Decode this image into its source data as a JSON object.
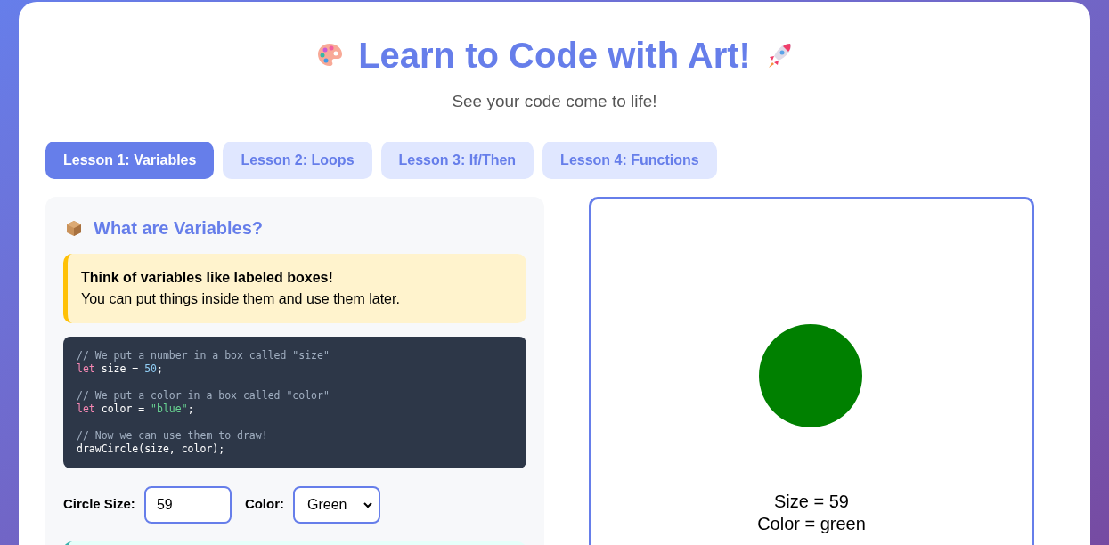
{
  "header": {
    "title": "Learn to Code with Art!",
    "subtitle": "See your code come to life!"
  },
  "tabs": [
    {
      "label": "Lesson 1: Variables",
      "selected": true
    },
    {
      "label": "Lesson 2: Loops",
      "selected": false
    },
    {
      "label": "Lesson 3: If/Then",
      "selected": false
    },
    {
      "label": "Lesson 4: Functions",
      "selected": false
    }
  ],
  "lesson": {
    "heading": "What are Variables?",
    "tip": {
      "title": "Think of variables like labeled boxes!",
      "text": "You can put things inside them and use them later."
    },
    "code": [
      {
        "kind": "line",
        "tokens": [
          {
            "kind": "comment",
            "text": "// We put a number in a box called \"size\""
          }
        ]
      },
      {
        "kind": "line",
        "tokens": [
          {
            "kind": "keyword",
            "text": "let"
          },
          {
            "kind": "plain",
            "text": " size = "
          },
          {
            "kind": "number",
            "text": "50"
          },
          {
            "kind": "plain",
            "text": ";"
          }
        ]
      },
      {
        "kind": "blank"
      },
      {
        "kind": "line",
        "tokens": [
          {
            "kind": "comment",
            "text": "// We put a color in a box called \"color\""
          }
        ]
      },
      {
        "kind": "line",
        "tokens": [
          {
            "kind": "keyword",
            "text": "let"
          },
          {
            "kind": "plain",
            "text": " color = "
          },
          {
            "kind": "string",
            "text": "\"blue\""
          },
          {
            "kind": "plain",
            "text": ";"
          }
        ]
      },
      {
        "kind": "blank"
      },
      {
        "kind": "line",
        "tokens": [
          {
            "kind": "comment",
            "text": "// Now we can use them to draw!"
          }
        ]
      },
      {
        "kind": "line",
        "tokens": [
          {
            "kind": "plain",
            "text": "drawCircle(size, color);"
          }
        ]
      }
    ],
    "size_field": {
      "label": "Circle Size:",
      "value": "59"
    },
    "color_field": {
      "label": "Color:",
      "value": "Green"
    }
  },
  "canvas": {
    "shapes": [
      {
        "kind": "circle",
        "color": "#008000"
      }
    ],
    "lines": [
      "Size = 59",
      "Color = green"
    ]
  }
}
